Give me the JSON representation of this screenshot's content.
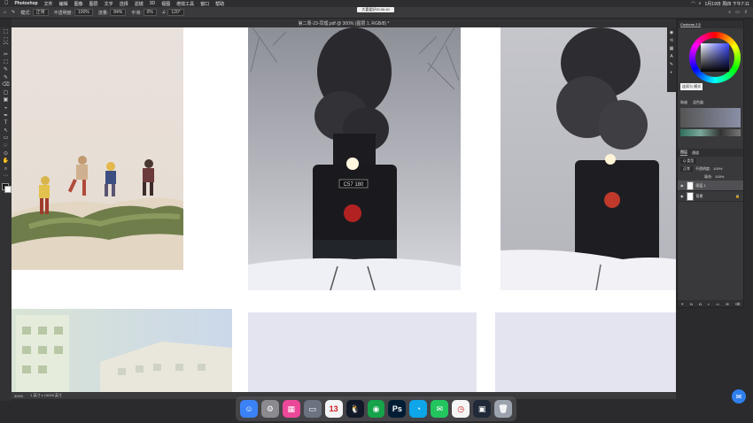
{
  "menubar": {
    "apple": "",
    "app_name": "Photoshop",
    "items": [
      "文件",
      "编辑",
      "图像",
      "图层",
      "文字",
      "选择",
      "滤镜",
      "3D",
      "视图",
      "增效工具",
      "窗口",
      "帮助"
    ],
    "clock": "1月19日 周四 下午7:11"
  },
  "options": {
    "mode_label": "模式:",
    "mode_value": "正常",
    "opacity_label": "不透明度:",
    "opacity_value": "100%",
    "flow_label": "流量:",
    "flow_value": "84%",
    "smooth_label": "平滑:",
    "smooth_value": "0%",
    "angle_value": "120°"
  },
  "recording_banner": "大喜爱好00:06:40",
  "doc_tab": "第二周-23-同理.pdf @ 300% (图层 1, RGB/8) *",
  "toolbar": [
    "⬚",
    "⬚",
    "⌒",
    "✂",
    "⬚",
    "✎",
    "✎",
    "⌫",
    "▢",
    "▣",
    "◒",
    "✒",
    "T",
    "↖",
    "▭",
    "☞",
    "⊙",
    "✋",
    "⌕",
    "⋯"
  ],
  "status": {
    "zoom": "300%",
    "doc_info": "1 英寸 x 13000 英寸"
  },
  "color_panel": {
    "title": "Coolorus 2.5",
    "tooltip": "连续与 模式",
    "tab_harmony": "和谐",
    "tab_mixer": "混色器"
  },
  "layers_panel": {
    "tabs": [
      "图层",
      "通道"
    ],
    "filter_label": "Q 类型",
    "blend_mode": "正常",
    "opacity_label": "不透明度:",
    "opacity_value": "100%",
    "fill_label": "填充:",
    "fill_value": "100%",
    "layers": [
      {
        "name": "图层 1",
        "active": true
      },
      {
        "name": "背景",
        "active": false
      }
    ]
  },
  "dock_icons": [
    {
      "name": "finder",
      "glyph": "☺",
      "color": "#3b82f6"
    },
    {
      "name": "launchpad",
      "glyph": "⚙",
      "color": "#8a8a8f"
    },
    {
      "name": "apps",
      "glyph": "▦",
      "color": "#ec4899"
    },
    {
      "name": "preview",
      "glyph": "▭",
      "color": "#6b7280"
    },
    {
      "name": "calendar",
      "glyph": "13",
      "color": "#f3f4f6"
    },
    {
      "name": "qq",
      "glyph": "🐧",
      "color": "#111827"
    },
    {
      "name": "chrome",
      "glyph": "◉",
      "color": "#16a34a"
    },
    {
      "name": "photoshop",
      "glyph": "Ps",
      "color": "#001d34"
    },
    {
      "name": "edge",
      "glyph": "◔",
      "color": "#0ea5e9"
    },
    {
      "name": "wechat",
      "glyph": "✉",
      "color": "#22c55e"
    },
    {
      "name": "clock",
      "glyph": "◷",
      "color": "#f5f5f5"
    },
    {
      "name": "terminal",
      "glyph": "▣",
      "color": "#1f2937"
    },
    {
      "name": "trash",
      "glyph": "🗑",
      "color": "#9ca3af"
    }
  ],
  "colors": {
    "train_smoke": "#3e3e42",
    "snow": "#eeeef4",
    "sky_gray": "#aeb0b8",
    "sand": "#e7ddd2",
    "placeholder": "#e4e4f0",
    "accent_blue": "#2f80ed"
  }
}
